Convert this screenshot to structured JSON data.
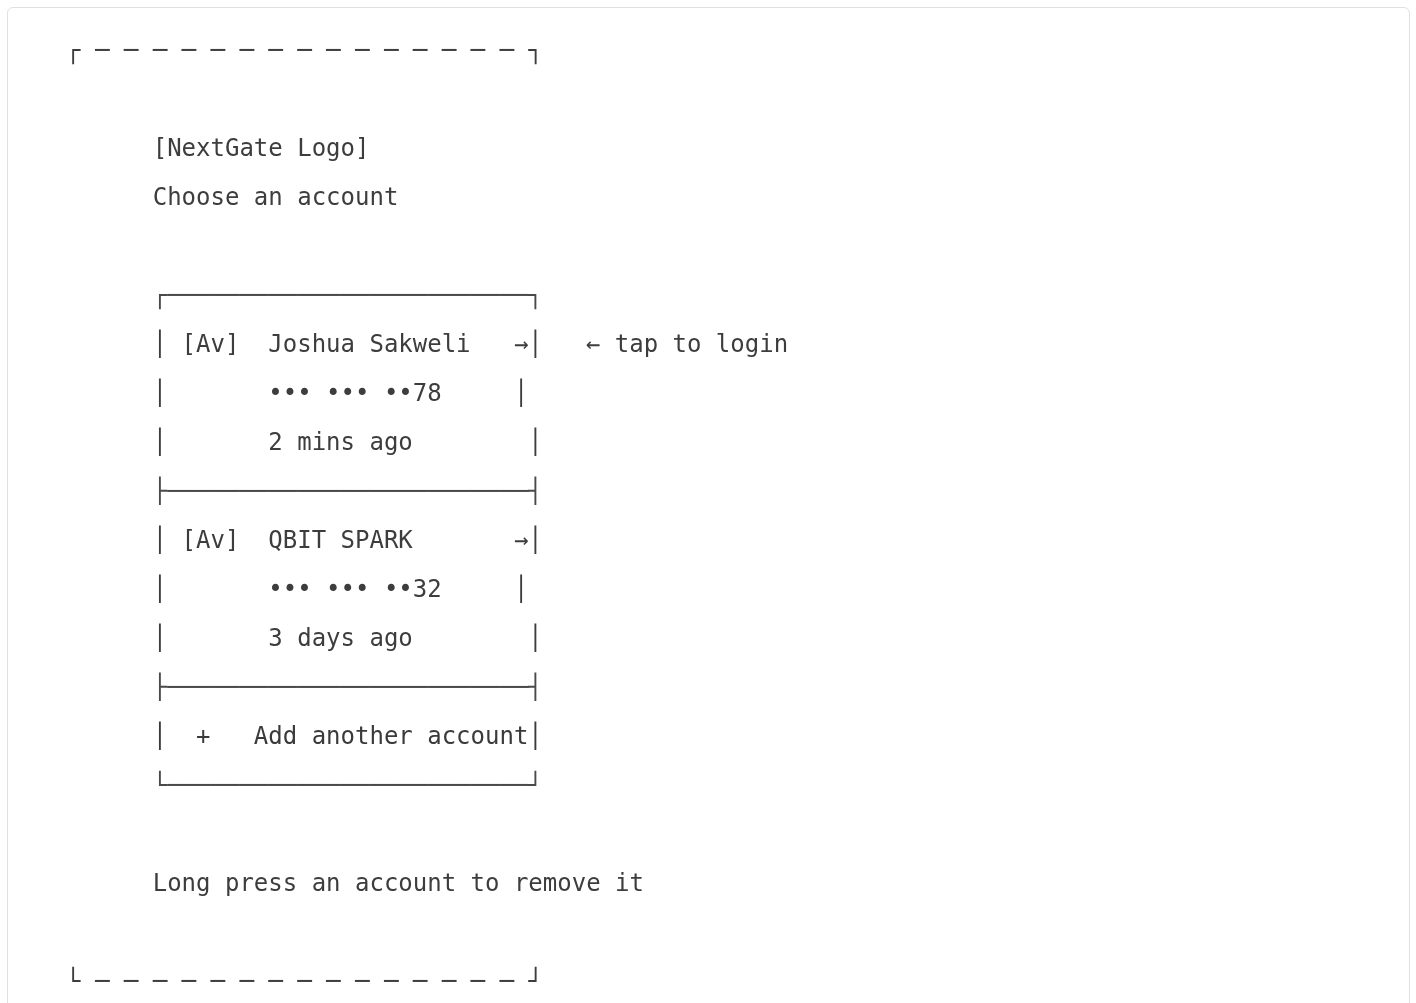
{
  "frame_top": "┌ ─ ─ ─ ─ ─ ─ ─ ─ ─ ─ ─ ─ ─ ─ ─ ┐",
  "logo_placeholder": "[NextGate Logo]",
  "heading": "Choose an account",
  "account_box": [
    {
      "kind": "border",
      "text": "┌─────────────────────────┐"
    },
    {
      "kind": "account",
      "text": "│ [Av]  Joshua Sakweli   →│",
      "note": "← tap to login"
    },
    {
      "kind": "account",
      "text": "│       ••• ••• ••78     │"
    },
    {
      "kind": "account",
      "text": "│       2 mins ago        │"
    },
    {
      "kind": "border",
      "text": "├─────────────────────────┤"
    },
    {
      "kind": "account",
      "text": "│ [Av]  QBIT SPARK       →│"
    },
    {
      "kind": "account",
      "text": "│       ••• ••• ••32     │"
    },
    {
      "kind": "account",
      "text": "│       3 days ago        │"
    },
    {
      "kind": "border",
      "text": "├─────────────────────────┤"
    },
    {
      "kind": "add",
      "text": "│  +   Add another account│"
    },
    {
      "kind": "border",
      "text": "└─────────────────────────┘"
    }
  ],
  "hint": "Long press an account to remove it",
  "frame_bottom": "└ ─ ─ ─ ─ ─ ─ ─ ─ ─ ─ ─ ─ ─ ─ ─ ┘"
}
